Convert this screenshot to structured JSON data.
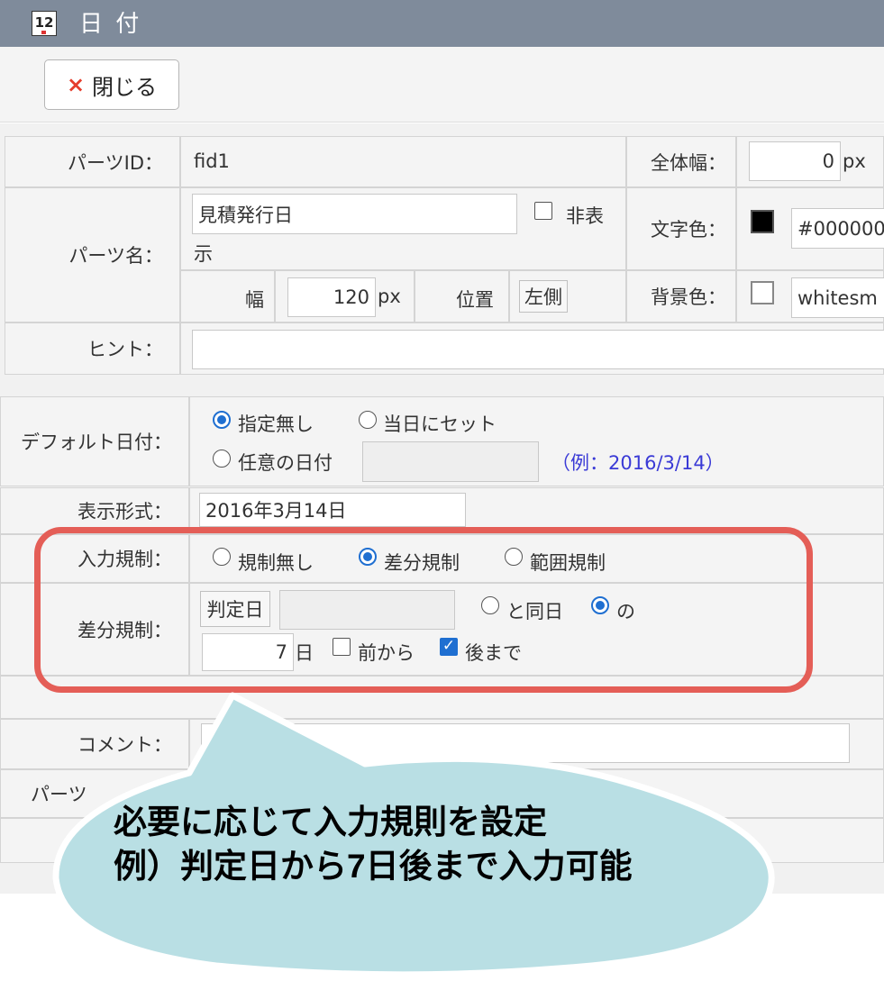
{
  "window": {
    "title": "日 付",
    "icon_text": "12"
  },
  "toolbar": {
    "close_icon": "×",
    "close_label": "閉じる"
  },
  "parts_id": {
    "label": "パーツID：",
    "value": "fid1"
  },
  "full_width": {
    "label": "全体幅：",
    "value": "0",
    "unit": "px"
  },
  "parts_name": {
    "label": "パーツ名：",
    "value": "見積発行日",
    "hide_label": "非表",
    "hide_label_wrap": "示",
    "hide_checked": false,
    "width_label": "幅",
    "width_value": "120",
    "width_unit": "px",
    "position_label": "位置",
    "position_value": "左側"
  },
  "text_color": {
    "label": "文字色：",
    "value": "#000000",
    "swatch": "#000000"
  },
  "bg_color": {
    "label": "背景色：",
    "value": "whitesm",
    "swatch": "#ffffff"
  },
  "hint": {
    "label": "ヒント：",
    "value": ""
  },
  "default_date": {
    "label": "デフォルト日付：",
    "options": [
      "指定無し",
      "当日にセット",
      "任意の日付"
    ],
    "selected": 0,
    "arbitrary_value": "",
    "example": "（例：2016/3/14）"
  },
  "display_format": {
    "label": "表示形式：",
    "value": "2016年3月14日"
  },
  "input_rule": {
    "label": "入力規制：",
    "options": [
      "規制無し",
      "差分規制",
      "範囲規制"
    ],
    "selected": 1
  },
  "diff_rule": {
    "label": "差分規制：",
    "judge_button": "判定日",
    "judge_value": "",
    "same_day_label": "と同日",
    "of_label": "の",
    "same_day_selected": false,
    "of_selected": true,
    "days_value": "7",
    "days_unit": "日",
    "before_label": "前から",
    "before_checked": false,
    "after_label": "後まで",
    "after_checked": true
  },
  "comment": {
    "label": "コメント：",
    "value": ""
  },
  "parts_partial": {
    "label": "パーツ"
  },
  "callout": {
    "line1": "必要に応じて入力規則を設定",
    "line2": "例）判定日から7日後まで入力可能"
  },
  "colors": {
    "titlebar": "#7f8b9b",
    "highlight": "#e45e57",
    "bubble": "#b9dfe4",
    "radio_accent": "#1f6fd1",
    "example_text": "#3a3ad6"
  }
}
